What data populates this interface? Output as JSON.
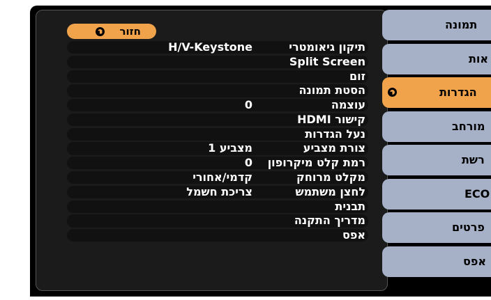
{
  "back_button": {
    "label": "חזור"
  },
  "rows": [
    {
      "label": "תיקון גיאומטרי",
      "value": "H/V-Keystone",
      "value_dir": "ltr"
    },
    {
      "label": "Split Screen",
      "value": ""
    },
    {
      "label": "זום",
      "value": ""
    },
    {
      "label": "הסטת תמונה",
      "value": ""
    },
    {
      "label": "עוצמה",
      "value": "0"
    },
    {
      "label": "קישור HDMI",
      "value": ""
    },
    {
      "label": "נעל הגדרות",
      "value": ""
    },
    {
      "label": "צורת מצביע",
      "value": "מצביע 1"
    },
    {
      "label": "רמת קלט מיקרופון",
      "value": "0"
    },
    {
      "label": "מקלט מרוחק",
      "value": "קדמי/אחורי"
    },
    {
      "label": "לחצן משתמש",
      "value": "צריכת חשמל"
    },
    {
      "label": "תבנית",
      "value": ""
    },
    {
      "label": "מדריך התקנה",
      "value": ""
    },
    {
      "label": "אפס",
      "value": ""
    }
  ],
  "menu": [
    {
      "label": "תמונה",
      "active": false
    },
    {
      "label": "אות",
      "active": false
    },
    {
      "label": "הגדרות",
      "active": true
    },
    {
      "label": "מורחב",
      "active": false
    },
    {
      "label": "רשת",
      "active": false
    },
    {
      "label": "ECO",
      "active": false
    },
    {
      "label": "פרטים",
      "active": false
    },
    {
      "label": "אפס",
      "active": false
    }
  ],
  "colors": {
    "accent": "#f0a34a",
    "menu_bg": "#a6b1c8",
    "panel_bg": "#1b1b1b",
    "screen_bg": "#000000"
  }
}
